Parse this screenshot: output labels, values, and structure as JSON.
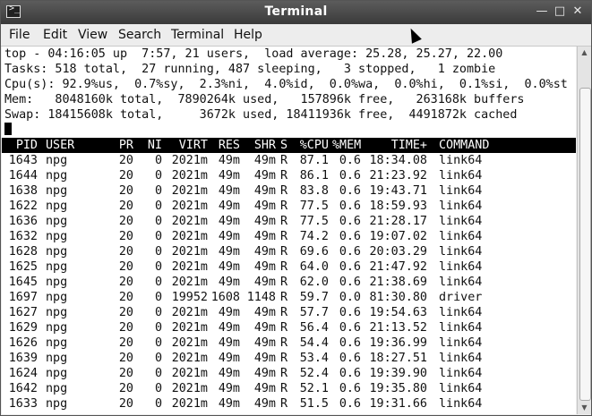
{
  "window": {
    "title": "Terminal",
    "icon": "terminal-icon"
  },
  "menu": [
    "File",
    "Edit",
    "View",
    "Search",
    "Terminal",
    "Help"
  ],
  "summary": [
    "top - 04:16:05 up  7:57, 21 users,  load average: 25.28, 25.27, 22.00",
    "Tasks: 518 total,  27 running, 487 sleeping,   3 stopped,   1 zombie",
    "Cpu(s): 92.9%us,  0.7%sy,  2.3%ni,  4.0%id,  0.0%wa,  0.0%hi,  0.1%si,  0.0%st",
    "Mem:   8048160k total,  7890264k used,   157896k free,   263168k buffers",
    "Swap: 18415608k total,     3672k used, 18411936k free,  4491872k cached"
  ],
  "columns": [
    "PID",
    "USER",
    "PR",
    "NI",
    "VIRT",
    "RES",
    "SHR",
    "S",
    "%CPU",
    "%MEM",
    "TIME+",
    "COMMAND"
  ],
  "processes": [
    [
      "1643",
      "npg",
      "20",
      "0",
      "2021m",
      "49m",
      "49m",
      "R",
      "87.1",
      "0.6",
      "18:34.08",
      "link64"
    ],
    [
      "1644",
      "npg",
      "20",
      "0",
      "2021m",
      "49m",
      "49m",
      "R",
      "86.1",
      "0.6",
      "21:23.92",
      "link64"
    ],
    [
      "1638",
      "npg",
      "20",
      "0",
      "2021m",
      "49m",
      "49m",
      "R",
      "83.8",
      "0.6",
      "19:43.71",
      "link64"
    ],
    [
      "1622",
      "npg",
      "20",
      "0",
      "2021m",
      "49m",
      "49m",
      "R",
      "77.5",
      "0.6",
      "18:59.93",
      "link64"
    ],
    [
      "1636",
      "npg",
      "20",
      "0",
      "2021m",
      "49m",
      "49m",
      "R",
      "77.5",
      "0.6",
      "21:28.17",
      "link64"
    ],
    [
      "1632",
      "npg",
      "20",
      "0",
      "2021m",
      "49m",
      "49m",
      "R",
      "74.2",
      "0.6",
      "19:07.02",
      "link64"
    ],
    [
      "1628",
      "npg",
      "20",
      "0",
      "2021m",
      "49m",
      "49m",
      "R",
      "69.6",
      "0.6",
      "20:03.29",
      "link64"
    ],
    [
      "1625",
      "npg",
      "20",
      "0",
      "2021m",
      "49m",
      "49m",
      "R",
      "64.0",
      "0.6",
      "21:47.92",
      "link64"
    ],
    [
      "1645",
      "npg",
      "20",
      "0",
      "2021m",
      "49m",
      "49m",
      "R",
      "62.0",
      "0.6",
      "21:38.69",
      "link64"
    ],
    [
      "1697",
      "npg",
      "20",
      "0",
      "19952",
      "1608",
      "1148",
      "R",
      "59.7",
      "0.0",
      "81:30.80",
      "driver"
    ],
    [
      "1627",
      "npg",
      "20",
      "0",
      "2021m",
      "49m",
      "49m",
      "R",
      "57.7",
      "0.6",
      "19:54.63",
      "link64"
    ],
    [
      "1629",
      "npg",
      "20",
      "0",
      "2021m",
      "49m",
      "49m",
      "R",
      "56.4",
      "0.6",
      "21:13.52",
      "link64"
    ],
    [
      "1626",
      "npg",
      "20",
      "0",
      "2021m",
      "49m",
      "49m",
      "R",
      "54.4",
      "0.6",
      "19:36.99",
      "link64"
    ],
    [
      "1639",
      "npg",
      "20",
      "0",
      "2021m",
      "49m",
      "49m",
      "R",
      "53.4",
      "0.6",
      "18:27.51",
      "link64"
    ],
    [
      "1624",
      "npg",
      "20",
      "0",
      "2021m",
      "49m",
      "49m",
      "R",
      "52.4",
      "0.6",
      "19:39.90",
      "link64"
    ],
    [
      "1642",
      "npg",
      "20",
      "0",
      "2021m",
      "49m",
      "49m",
      "R",
      "52.1",
      "0.6",
      "19:35.80",
      "link64"
    ],
    [
      "1633",
      "npg",
      "20",
      "0",
      "2021m",
      "49m",
      "49m",
      "R",
      "51.5",
      "0.6",
      "19:31.66",
      "link64"
    ]
  ]
}
